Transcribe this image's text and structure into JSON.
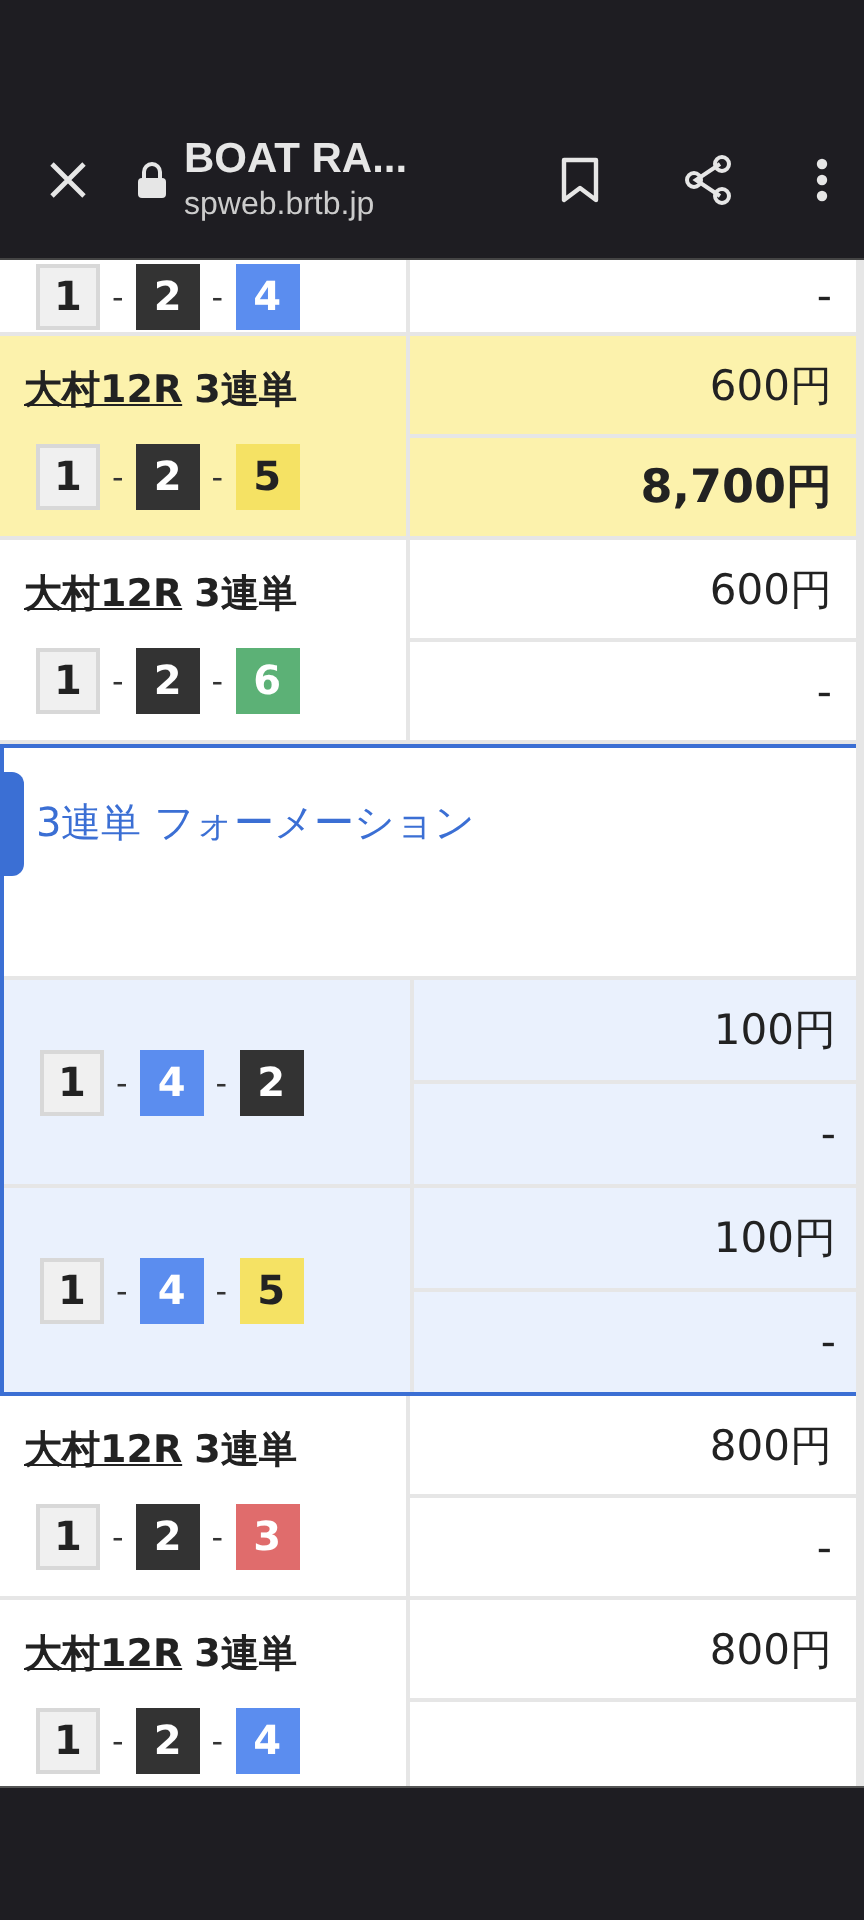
{
  "toolbar": {
    "title": "BOAT RA...",
    "url": "spweb.brtb.jp"
  },
  "rows": [
    {
      "kind": "bet",
      "highlighted": false,
      "separators": [
        "-",
        "-"
      ],
      "boats": [
        {
          "number": "1",
          "color": "#f0f0f0"
        },
        {
          "number": "2",
          "color": "#333333"
        },
        {
          "number": "4",
          "color": "#5b8def"
        }
      ],
      "payout": "-"
    },
    {
      "kind": "bet",
      "highlighted": true,
      "venue": "大村12R",
      "bet_type": "3連単",
      "amount": "600円",
      "separators": [
        "-",
        "-"
      ],
      "boats": [
        {
          "number": "1",
          "color": "#f0f0f0"
        },
        {
          "number": "2",
          "color": "#333333"
        },
        {
          "number": "5",
          "color": "#f5e264"
        }
      ],
      "payout": "8,700円"
    },
    {
      "kind": "bet",
      "highlighted": false,
      "venue": "大村12R",
      "bet_type": "3連単",
      "amount": "600円",
      "separators": [
        "-",
        "-"
      ],
      "boats": [
        {
          "number": "1",
          "color": "#f0f0f0"
        },
        {
          "number": "2",
          "color": "#333333"
        },
        {
          "number": "6",
          "color": "#5cb176"
        }
      ],
      "payout": "-"
    },
    {
      "kind": "formation",
      "title": "3連単 フォーメーション",
      "items": [
        {
          "separators": [
            "-",
            "-"
          ],
          "boats": [
            {
              "number": "1",
              "color": "#f0f0f0"
            },
            {
              "number": "4",
              "color": "#5b8def"
            },
            {
              "number": "2",
              "color": "#333333"
            }
          ],
          "amount": "100円",
          "payout": "-"
        },
        {
          "separators": [
            "-",
            "-"
          ],
          "boats": [
            {
              "number": "1",
              "color": "#f0f0f0"
            },
            {
              "number": "4",
              "color": "#5b8def"
            },
            {
              "number": "5",
              "color": "#f5e264"
            }
          ],
          "amount": "100円",
          "payout": "-"
        }
      ]
    },
    {
      "kind": "bet",
      "highlighted": false,
      "venue": "大村12R",
      "bet_type": "3連単",
      "amount": "800円",
      "separators": [
        "-",
        "-"
      ],
      "boats": [
        {
          "number": "1",
          "color": "#f0f0f0"
        },
        {
          "number": "2",
          "color": "#333333"
        },
        {
          "number": "3",
          "color": "#e06c6c"
        }
      ],
      "payout": "-"
    },
    {
      "kind": "bet",
      "highlighted": false,
      "venue": "大村12R",
      "bet_type": "3連単",
      "amount": "800円",
      "separators": [
        "-",
        "-"
      ],
      "boats": [
        {
          "number": "1",
          "color": "#f0f0f0"
        },
        {
          "number": "2",
          "color": "#333333"
        },
        {
          "number": "4",
          "color": "#5b8def"
        }
      ]
    }
  ]
}
